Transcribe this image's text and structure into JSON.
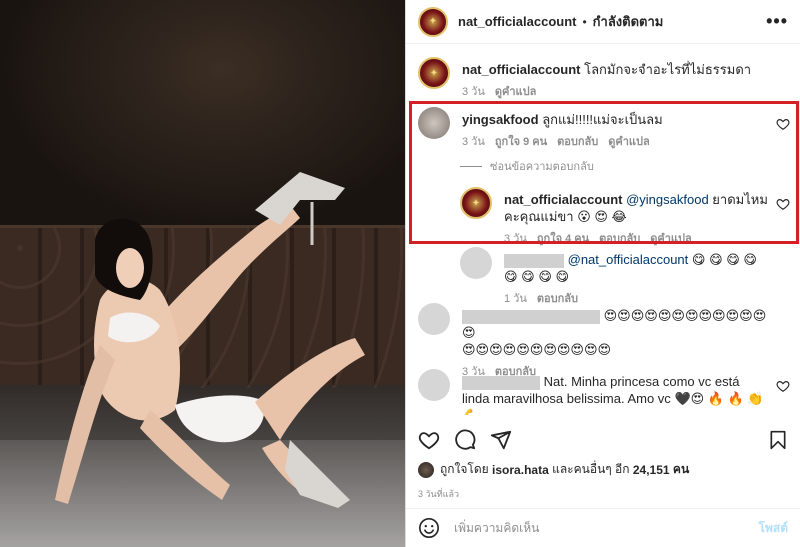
{
  "header": {
    "username": "nat_officialaccount",
    "dot": "•",
    "following": "กำลังติดตาม",
    "more": "•••"
  },
  "caption": {
    "username": "nat_officialaccount",
    "text": "โลกมักจะจำอะไรที่ไม่ธรรมดา",
    "time": "3 วัน",
    "translate": "ดูคำแปล"
  },
  "comments": [
    {
      "username": "yingsakfood",
      "text": "ลูกแม่!!!!!แม่จะเป็นลม",
      "time": "3 วัน",
      "likes": "ถูกใจ 9 คน",
      "reply": "ตอบกลับ",
      "translate": "ดูคำแปล"
    }
  ],
  "hide_replies": "ซ่อนข้อความตอบกลับ",
  "reply": {
    "username": "nat_officialaccount",
    "mention": "@yingsakfood",
    "text": "ยาดมไหมคะคุณแม่ขา",
    "emoji": "😮 😍 😂",
    "time": "3 วัน",
    "likes": "ถูกใจ 4 คน",
    "reply": "ตอบกลับ",
    "translate": "ดูคำแปล"
  },
  "comment2": {
    "mention": "@nat_officialaccount",
    "emoji": "😋 😋 😋 😋 😋 😋 😋 😋",
    "time": "1 วัน",
    "reply": "ตอบกลับ"
  },
  "comment3": {
    "emoji_line1": "😍😍😍😍😍😍😍😍😍😍😍😍😍",
    "emoji_line2": "😍😍😍😍😍😍😍😍😍😍😍",
    "time": "3 วัน",
    "reply": "ตอบกลับ"
  },
  "comment4": {
    "text": "Nat. Minha princesa como vc está linda maravilhosa belissima. Amo vc",
    "emoji": "🖤😍 🔥 🔥 👏 💪"
  },
  "likes": {
    "prefix": "ถูกใจโดย",
    "user": "isora.hata",
    "middle": "และคนอื่นๆ อีก",
    "count": "24,151",
    "suffix": "คน"
  },
  "date": "3 วันที่แล้ว",
  "add_comment": {
    "placeholder": "เพิ่มความคิดเห็น",
    "post": "โพสต์"
  },
  "colors": {
    "highlight": "#d51f26",
    "link": "#00376b",
    "muted": "#8e8e8e",
    "post_disabled": "#b2dffc"
  },
  "icons": [
    "heart-icon",
    "comment-icon",
    "share-icon",
    "bookmark-icon",
    "emoji-icon",
    "more-icon"
  ]
}
